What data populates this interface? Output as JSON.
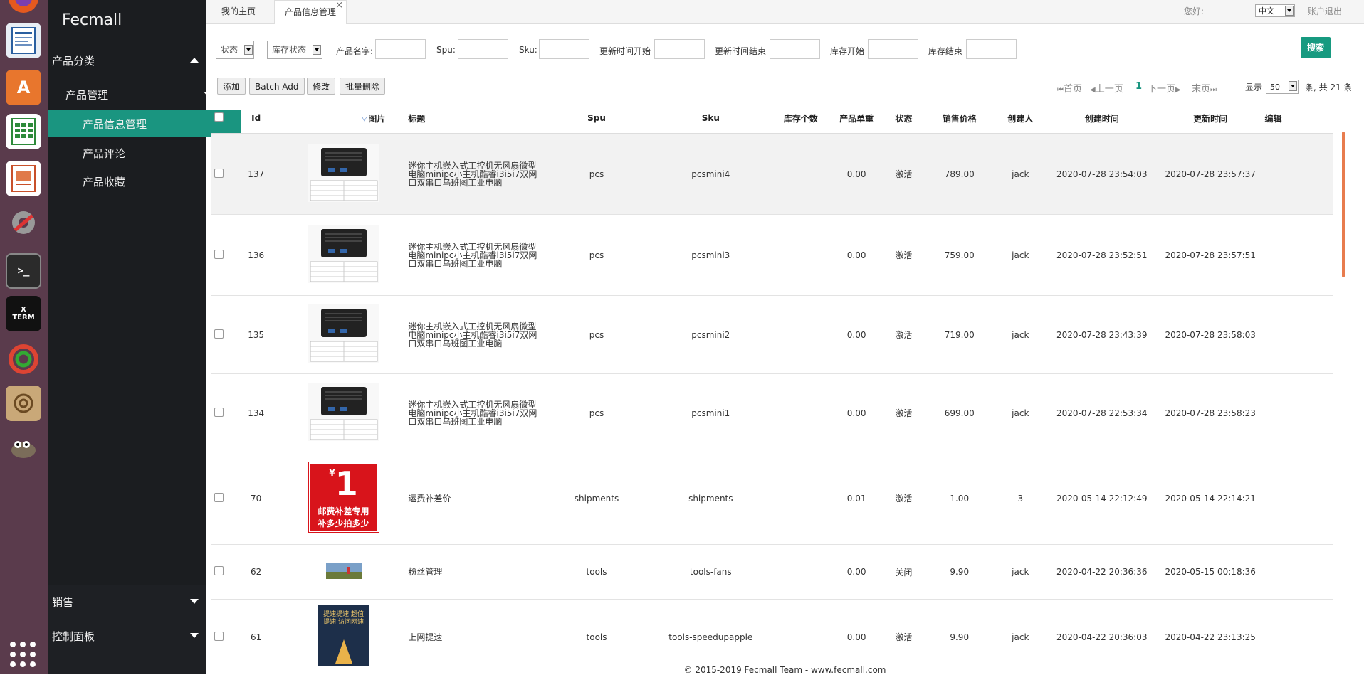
{
  "dock": {
    "icons": [
      "firefox-icon",
      "writer-icon",
      "software-center-icon",
      "calc-icon",
      "impress-icon",
      "settings-icon",
      "terminal-icon",
      "xterm-icon",
      "gs-icon",
      "archive-icon",
      "gimp-icon",
      "apps-grid-icon"
    ]
  },
  "sidebar": {
    "brand": "Fecmall",
    "category": "产品分类",
    "group": "产品管理",
    "items": [
      "产品信息管理",
      "产品评论",
      "产品收藏"
    ],
    "bottom": [
      "销售",
      "控制面板"
    ]
  },
  "tabs": {
    "home": "我的主页",
    "current": "产品信息管理",
    "close": "×"
  },
  "header": {
    "greeting": "您好:",
    "lang": "中文",
    "logout": "账户退出"
  },
  "filters": {
    "status": "状态",
    "stock_status": "库存状态",
    "name": "产品名字:",
    "spu": "Spu:",
    "sku": "Sku:",
    "updated_start": "更新时间开始",
    "updated_end": "更新时间结束",
    "stock_start": "库存开始",
    "stock_end": "库存结束",
    "search": "搜索"
  },
  "actions": {
    "add": "添加",
    "batch_add": "Batch Add",
    "edit": "修改",
    "batch_delete": "批量删除"
  },
  "pager": {
    "first": "首页",
    "prev": "上一页",
    "page": "1",
    "next": "下一页",
    "last": "末页",
    "show": "显示",
    "per_page": "50",
    "total": "条, 共 21 条"
  },
  "columns": [
    "Id",
    "图片",
    "标题",
    "Spu",
    "Sku",
    "库存个数",
    "产品单重",
    "状态",
    "销售价格",
    "创建人",
    "创建时间",
    "更新时间",
    "编辑"
  ],
  "rows": [
    {
      "id": "137",
      "title": "迷你主机嵌入式工控机无风扇微型电脑minipc小主机酷睿i3i5i7双网口双串口乌班图工业电脑",
      "spu": "pcs",
      "sku": "pcsmini4",
      "qty": "",
      "weight": "0.00",
      "status": "激活",
      "price": "789.00",
      "creator": "jack",
      "created": "2020-07-28 23:54:03",
      "updated": "2020-07-28 23:57:37"
    },
    {
      "id": "136",
      "title": "迷你主机嵌入式工控机无风扇微型电脑minipc小主机酷睿i3i5i7双网口双串口乌班图工业电脑",
      "spu": "pcs",
      "sku": "pcsmini3",
      "qty": "",
      "weight": "0.00",
      "status": "激活",
      "price": "759.00",
      "creator": "jack",
      "created": "2020-07-28 23:52:51",
      "updated": "2020-07-28 23:57:51"
    },
    {
      "id": "135",
      "title": "迷你主机嵌入式工控机无风扇微型电脑minipc小主机酷睿i3i5i7双网口双串口乌班图工业电脑",
      "spu": "pcs",
      "sku": "pcsmini2",
      "qty": "",
      "weight": "0.00",
      "status": "激活",
      "price": "719.00",
      "creator": "jack",
      "created": "2020-07-28 23:43:39",
      "updated": "2020-07-28 23:58:03"
    },
    {
      "id": "134",
      "title": "迷你主机嵌入式工控机无风扇微型电脑minipc小主机酷睿i3i5i7双网口双串口乌班图工业电脑",
      "spu": "pcs",
      "sku": "pcsmini1",
      "qty": "",
      "weight": "0.00",
      "status": "激活",
      "price": "699.00",
      "creator": "jack",
      "created": "2020-07-28 22:53:34",
      "updated": "2020-07-28 23:58:23"
    },
    {
      "id": "70",
      "title": "运费补差价",
      "spu": "shipments",
      "sku": "shipments",
      "qty": "",
      "weight": "0.01",
      "status": "激活",
      "price": "1.00",
      "creator": "3",
      "created": "2020-05-14 22:12:49",
      "updated": "2020-05-14 22:14:21"
    },
    {
      "id": "62",
      "title": "粉丝管理",
      "spu": "tools",
      "sku": "tools-fans",
      "qty": "",
      "weight": "0.00",
      "status": "关闭",
      "price": "9.90",
      "creator": "jack",
      "created": "2020-04-22 20:36:36",
      "updated": "2020-05-15 00:18:36"
    },
    {
      "id": "61",
      "title": "上网提速",
      "spu": "tools",
      "sku": "tools-speedupapple",
      "qty": "",
      "weight": "0.00",
      "status": "激活",
      "price": "9.90",
      "creator": "jack",
      "created": "2020-04-22 20:36:03",
      "updated": "2020-04-22 23:13:25"
    }
  ],
  "images": {
    "shipping_big": "1",
    "shipping_currency": "¥",
    "shipping_line1": "邮费补差专用",
    "shipping_line2": "补多少拍多少",
    "poster_text": "提速提速 超值提速 访问网速"
  },
  "footer": "© 2015-2019 Fecmall Team - www.fecmall.com",
  "colors": {
    "accent": "#1a9580",
    "sidebar": "#1b1d20",
    "dock": "#5a3b4c"
  }
}
